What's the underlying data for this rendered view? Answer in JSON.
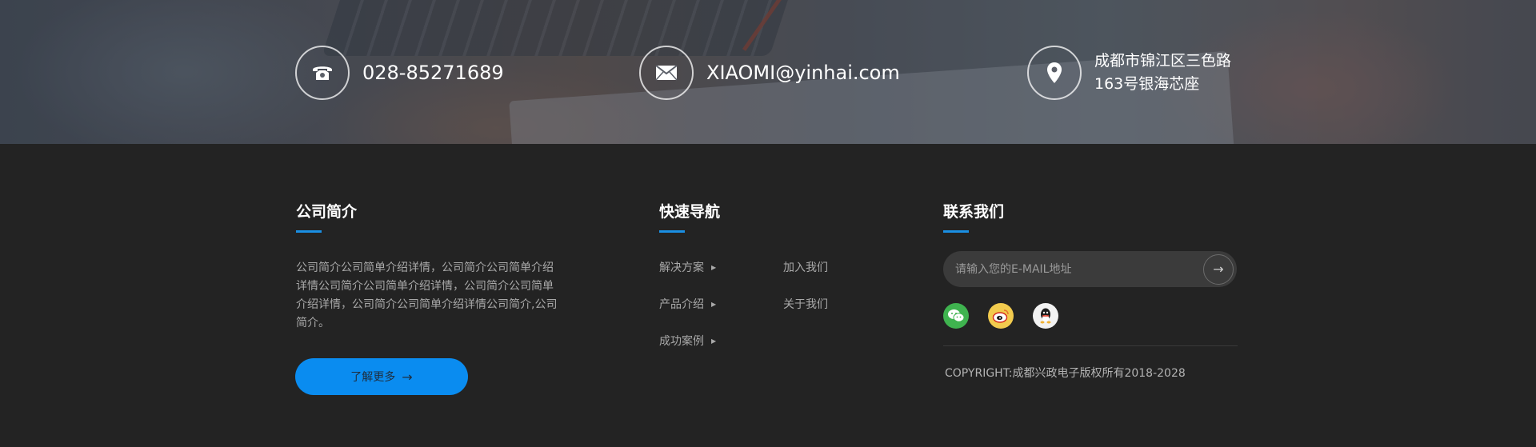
{
  "contacts": {
    "phone": {
      "icon": "phone-icon",
      "text": "028-85271689"
    },
    "email": {
      "icon": "mail-icon",
      "text": "XIAOMI@yinhai.com"
    },
    "address": {
      "icon": "location-pin-icon",
      "line1": "成都市锦江区三色路",
      "line2": "163号银海芯座"
    }
  },
  "about": {
    "title": "公司简介",
    "text": "公司简介公司简单介绍详情，公司简介公司简单介绍详情公司简介公司简单介绍详情，公司简介公司简单介绍详情，公司简介公司简单介绍详情公司简介,公司简介。",
    "button_label": "了解更多",
    "button_arrow": "→"
  },
  "quick_nav": {
    "title": "快速导航",
    "items": [
      {
        "label": "解决方案",
        "marker": "▶"
      },
      {
        "label": "产品介绍",
        "marker": "▶"
      },
      {
        "label": "成功案例",
        "marker": "▶"
      },
      {
        "label": "加入我们"
      },
      {
        "label": "关于我们"
      }
    ]
  },
  "contact_us": {
    "title": "联系我们",
    "email_placeholder": "请输入您的E-MAIL地址",
    "submit_arrow": "→",
    "social": [
      {
        "icon": "wechat-icon",
        "color": "#3fb34f"
      },
      {
        "icon": "weibo-icon",
        "color": "#f2cb4e"
      },
      {
        "icon": "qq-icon",
        "color": "#f2f2f2"
      }
    ],
    "copyright": "COPYRIGHT:成都兴政电子版权所有2018-2028"
  },
  "colors": {
    "accent": "#0a8cf0",
    "footer_bg": "#232323"
  }
}
